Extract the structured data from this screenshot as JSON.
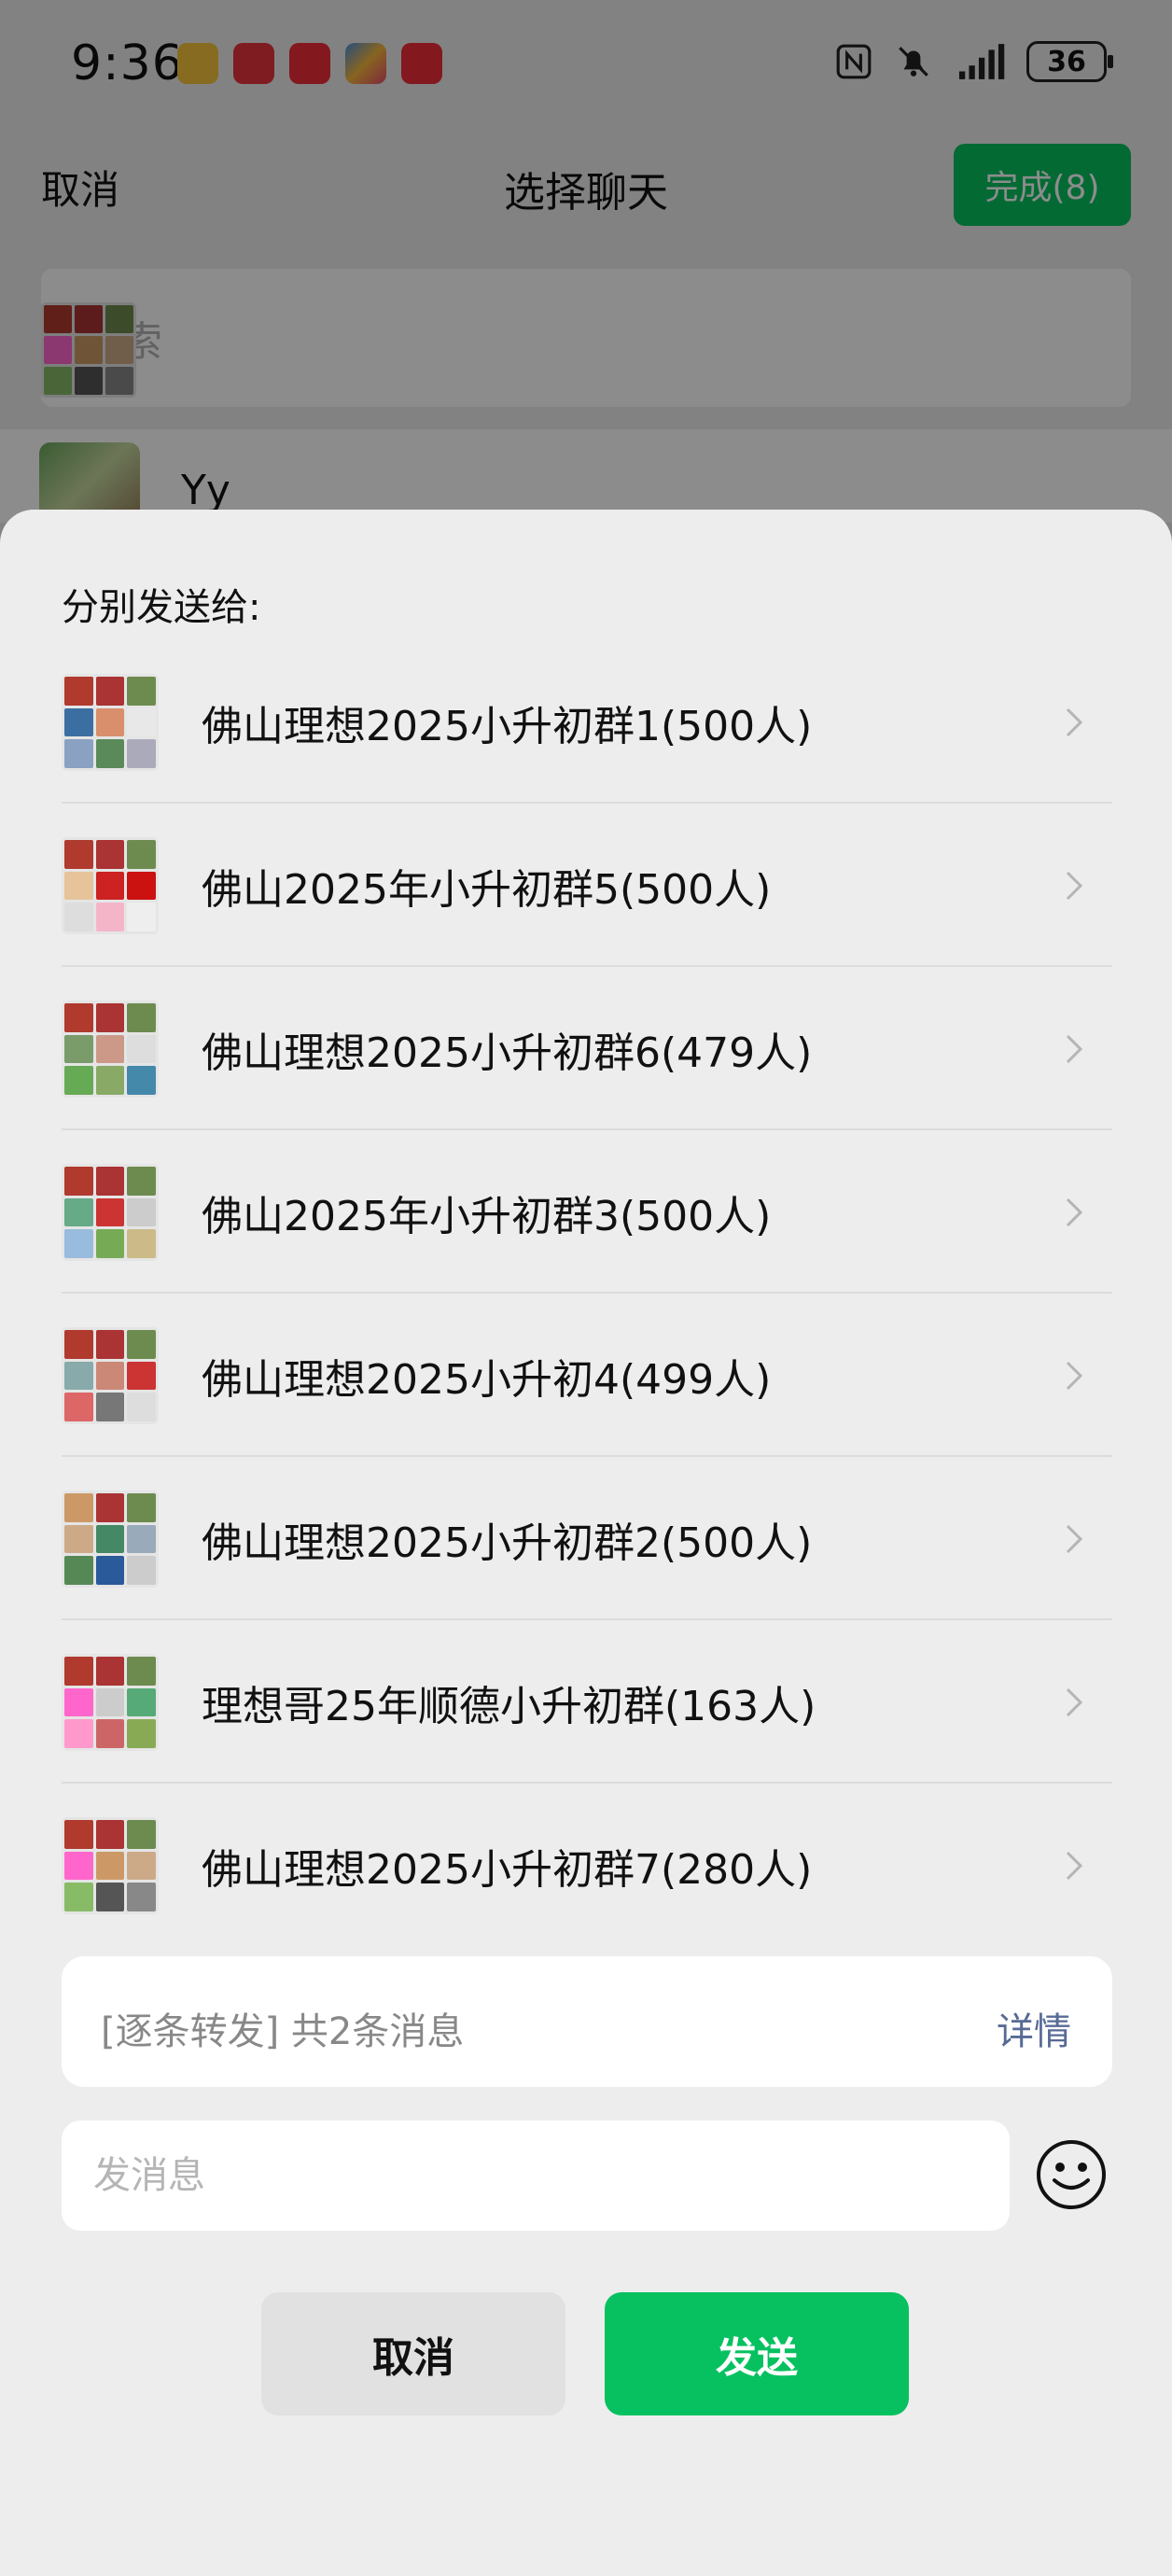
{
  "status_bar": {
    "time": "9:36",
    "battery": "36",
    "app_icons": [
      "weibo-icon",
      "huawei-icon",
      "red-book-icon",
      "tasks-app-icon",
      "red-book-icon"
    ],
    "system_icons": [
      "nfc-icon",
      "bell-off-icon",
      "signal-icon"
    ]
  },
  "nav": {
    "cancel": "取消",
    "title": "选择聊天",
    "done": "完成(8)"
  },
  "search": {
    "placeholder": "搜索"
  },
  "list_peek": {
    "name": "Yy"
  },
  "sheet": {
    "heading": "分别发送给:",
    "chats": [
      {
        "name": "佛山理想2025小升初群1(500人)"
      },
      {
        "name": "佛山2025年小升初群5(500人)"
      },
      {
        "name": "佛山理想2025小升初群6(479人)"
      },
      {
        "name": "佛山2025年小升初群3(500人)"
      },
      {
        "name": "佛山理想2025小升初4(499人)"
      },
      {
        "name": "佛山理想2025小升初群2(500人)"
      },
      {
        "name": "理想哥25年顺德小升初群(163人)"
      },
      {
        "name": "佛山理想2025小升初群7(280人)"
      }
    ],
    "message_summary": "[逐条转发] 共2条消息",
    "detail": "详情",
    "input_placeholder": "发消息",
    "cancel": "取消",
    "send": "发送"
  },
  "colors": {
    "accent_green": "#07c160",
    "link_blue": "#576b95"
  }
}
